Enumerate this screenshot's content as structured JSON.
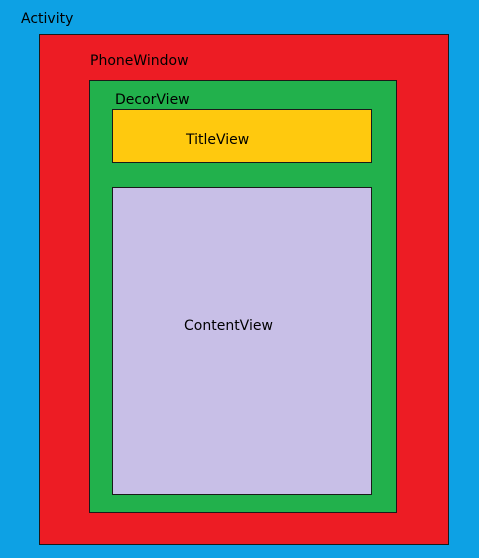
{
  "layers": {
    "activity": {
      "label": "Activity",
      "color": "#0da1e4"
    },
    "phone_window": {
      "label": "PhoneWindow",
      "color": "#ed1c24"
    },
    "decor_view": {
      "label": "DecorView",
      "color": "#22b14c"
    },
    "title_view": {
      "label": "TitleView",
      "color": "#ffc90e"
    },
    "content_view": {
      "label": "ContentView",
      "color": "#c8bfe7"
    }
  }
}
